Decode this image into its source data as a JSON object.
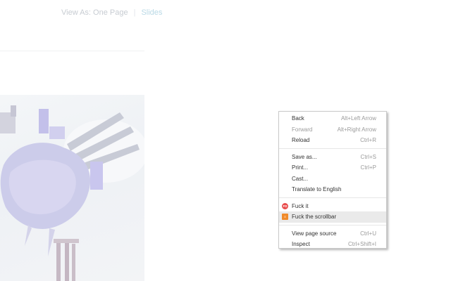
{
  "view_as": {
    "label": "View As: One Page",
    "separator": "|",
    "slides": "Slides"
  },
  "context_menu": {
    "back": {
      "label": "Back",
      "shortcut": "Alt+Left Arrow"
    },
    "forward": {
      "label": "Forward",
      "shortcut": "Alt+Right Arrow"
    },
    "reload": {
      "label": "Reload",
      "shortcut": "Ctrl+R"
    },
    "save_as": {
      "label": "Save as...",
      "shortcut": "Ctrl+S"
    },
    "print": {
      "label": "Print...",
      "shortcut": "Ctrl+P"
    },
    "cast": {
      "label": "Cast..."
    },
    "translate": {
      "label": "Translate to English"
    },
    "fuck_it": {
      "label": "Fuck it",
      "icon_text": "FD",
      "icon": "red-circle-extension-icon",
      "color": "#e84a4a"
    },
    "fuck_scrollbar": {
      "label": "Fuck the scrollbar",
      "icon_text": "≡",
      "icon": "orange-square-extension-icon",
      "color": "#f08a2a"
    },
    "view_source": {
      "label": "View page source",
      "shortcut": "Ctrl+U"
    },
    "inspect": {
      "label": "Inspect",
      "shortcut": "Ctrl+Shift+I"
    }
  }
}
